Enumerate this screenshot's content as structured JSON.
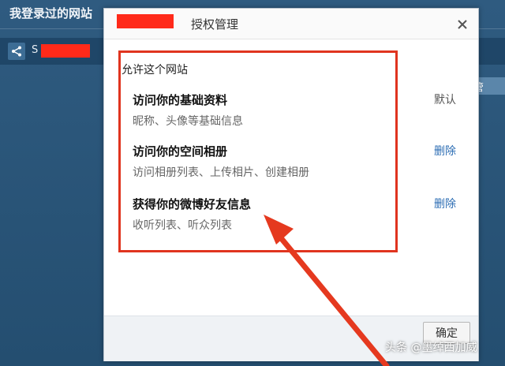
{
  "background": {
    "title": "我登录过的网站",
    "row_text": "S"
  },
  "dialog": {
    "title_suffix": "授权管理",
    "allow_label": "允许这个网站",
    "permissions": [
      {
        "title": "访问你的基础资料",
        "desc": "昵称、头像等基础信息",
        "action": "默认",
        "action_type": "default"
      },
      {
        "title": "访问你的空间相册",
        "desc": "访问相册列表、上传相片、创建相册",
        "action": "删除",
        "action_type": "link"
      },
      {
        "title": "获得你的微博好友信息",
        "desc": "收听列表、听众列表",
        "action": "删除",
        "action_type": "link"
      }
    ],
    "ok_label": "确定"
  },
  "icons": {
    "close": "close-icon",
    "share": "share-icon"
  },
  "colors": {
    "annotation_red": "#e0341f",
    "link_blue": "#2b6cb3",
    "page_bg": "#2c587c"
  },
  "watermark": "头条 @墨绰西加威"
}
